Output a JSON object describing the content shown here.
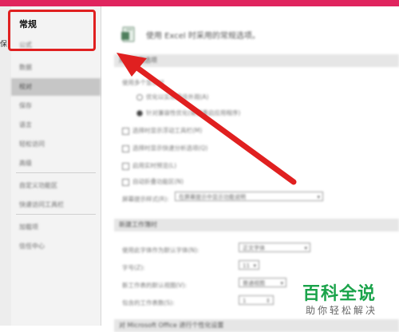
{
  "colors": {
    "top_bar": "#e0245e",
    "highlight": "#e02020",
    "arrow": "#e02020",
    "watermark": "#1aa34a"
  },
  "left_strip": {
    "glyph": "保"
  },
  "sidebar": {
    "items": [
      {
        "label": "常规",
        "selected": false
      },
      {
        "label": "公式",
        "selected": false
      },
      {
        "label": "数据",
        "selected": false
      },
      {
        "label": "校对",
        "selected": true
      },
      {
        "label": "保存",
        "selected": false
      },
      {
        "label": "语言",
        "selected": false
      },
      {
        "label": "轻松访问",
        "selected": false
      },
      {
        "label": "高级",
        "selected": false
      },
      {
        "label": "自定义功能区",
        "selected": false
      },
      {
        "label": "快速访问工具栏",
        "selected": false
      },
      {
        "label": "加载项",
        "selected": false
      },
      {
        "label": "信任中心",
        "selected": false
      }
    ]
  },
  "content": {
    "header_icon": "excel-options-icon",
    "header_text": "使用 Excel 时采用的常规选项。",
    "section_ui": "用户界面选项",
    "multi_display_label": "使用多个显示时",
    "radio_optimize_appearance": "优化以实现最佳外观(A)",
    "radio_optimize_compat": "针对兼容性优化(需要重启应用程序)",
    "chk_mini_toolbar": "选择时显示浮动工具栏(M)",
    "chk_quick_analysis": "选择时显示快速分析选项(Q)",
    "chk_live_preview": "启用实时预览(L)",
    "chk_collapse_ribbon": "自动折叠功能区(N)",
    "screentip_label": "屏幕提示样式(R):",
    "screentip_value": "在屏幕提示中显示功能说明",
    "section_new": "新建工作簿时",
    "font_label": "使用此字体作为默认字体(N):",
    "font_value": "正文字体",
    "size_label": "字号(Z):",
    "size_value": "11",
    "view_label": "新工作表的默认视图(V):",
    "view_value": "普通视图",
    "sheets_label": "包含的工作表数(S):",
    "sheets_value": "1",
    "section_personalize": "对 Microsoft Office 进行个性化设置"
  },
  "watermark": {
    "title": "百科全说",
    "subtitle": "助你轻松解决"
  }
}
